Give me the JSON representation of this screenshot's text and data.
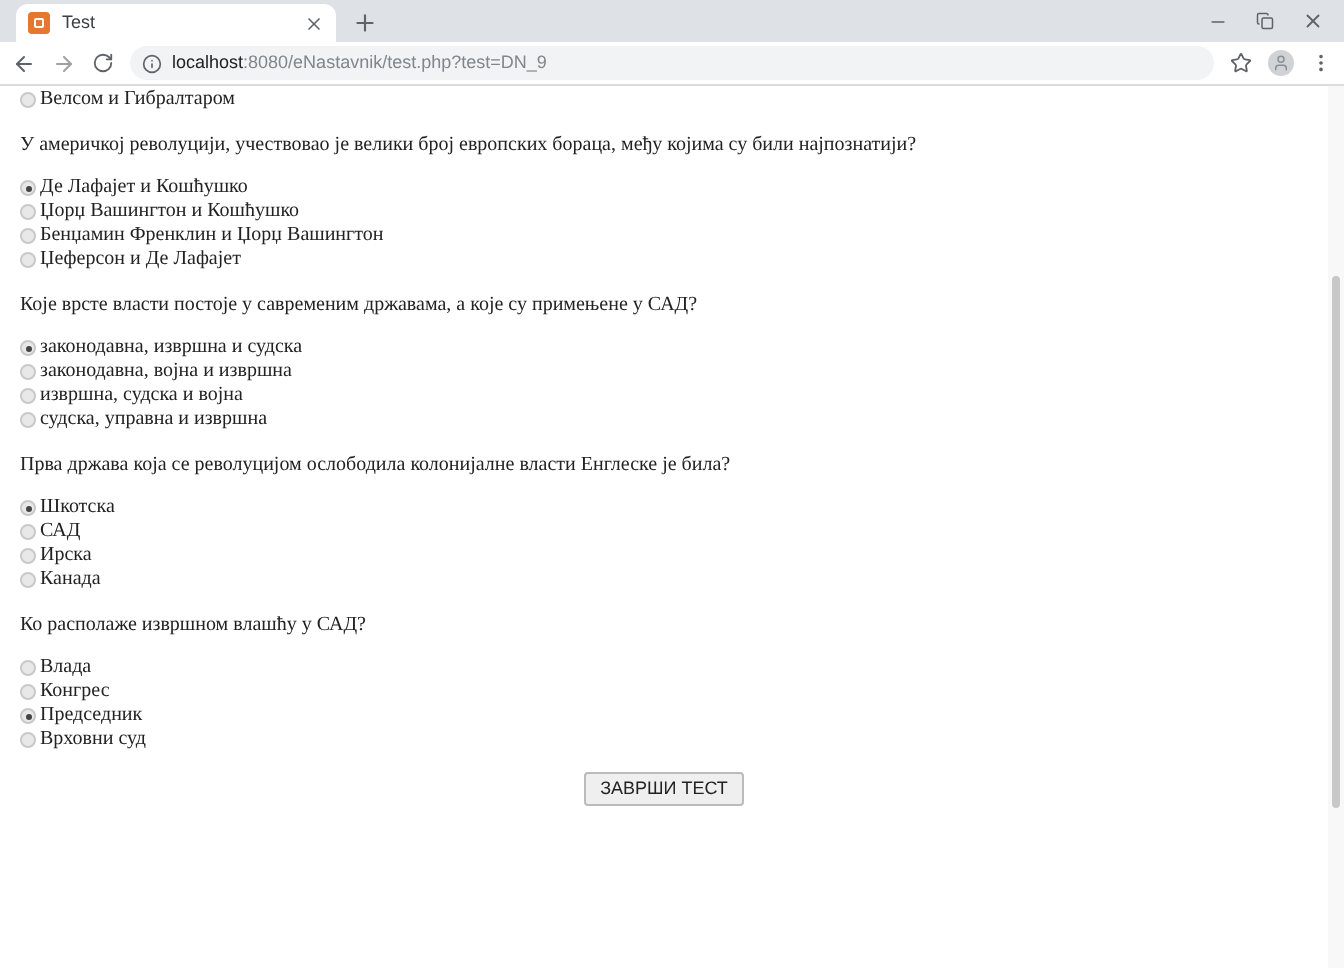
{
  "browser": {
    "tab_title": "Test",
    "url_host": "localhost",
    "url_path": ":8080/eNastavnik/test.php?test=DN_9"
  },
  "questions": [
    {
      "options": [
        {
          "label": "Велсом и Гибралтаром",
          "selected": false
        }
      ]
    },
    {
      "text": "У америчкој револуцији, учествовао је велики број европских бораца, међу којима су били најпознатији?",
      "options": [
        {
          "label": "Де Лафајет и Кошћушко",
          "selected": true
        },
        {
          "label": "Џорџ Вашингтон и Кошћушко",
          "selected": false
        },
        {
          "label": "Бенџамин Френклин и Џорџ Вашингтон",
          "selected": false
        },
        {
          "label": "Џеферсон и Де Лафајет",
          "selected": false
        }
      ]
    },
    {
      "text": "Које врсте власти постоје у савременим државама, а које су примењене у САД?",
      "options": [
        {
          "label": "законодавна, извршна и судска",
          "selected": true
        },
        {
          "label": "законодавна, војна и извршна",
          "selected": false
        },
        {
          "label": "извршна, судска и војна",
          "selected": false
        },
        {
          "label": "судска, управна и извршна",
          "selected": false
        }
      ]
    },
    {
      "text": "Прва држава која се револуцијом ослободила колонијалне власти Енглеске је била?",
      "options": [
        {
          "label": "Шкотска",
          "selected": true
        },
        {
          "label": "САД",
          "selected": false
        },
        {
          "label": "Ирска",
          "selected": false
        },
        {
          "label": "Канада",
          "selected": false
        }
      ]
    },
    {
      "text": "Ко располаже извршном влашћу у САД?",
      "options": [
        {
          "label": "Влада",
          "selected": false
        },
        {
          "label": "Конгрес",
          "selected": false
        },
        {
          "label": "Председник",
          "selected": true
        },
        {
          "label": "Врховни суд",
          "selected": false
        }
      ]
    }
  ],
  "submit_button": "ЗАВРШИ ТЕСТ"
}
